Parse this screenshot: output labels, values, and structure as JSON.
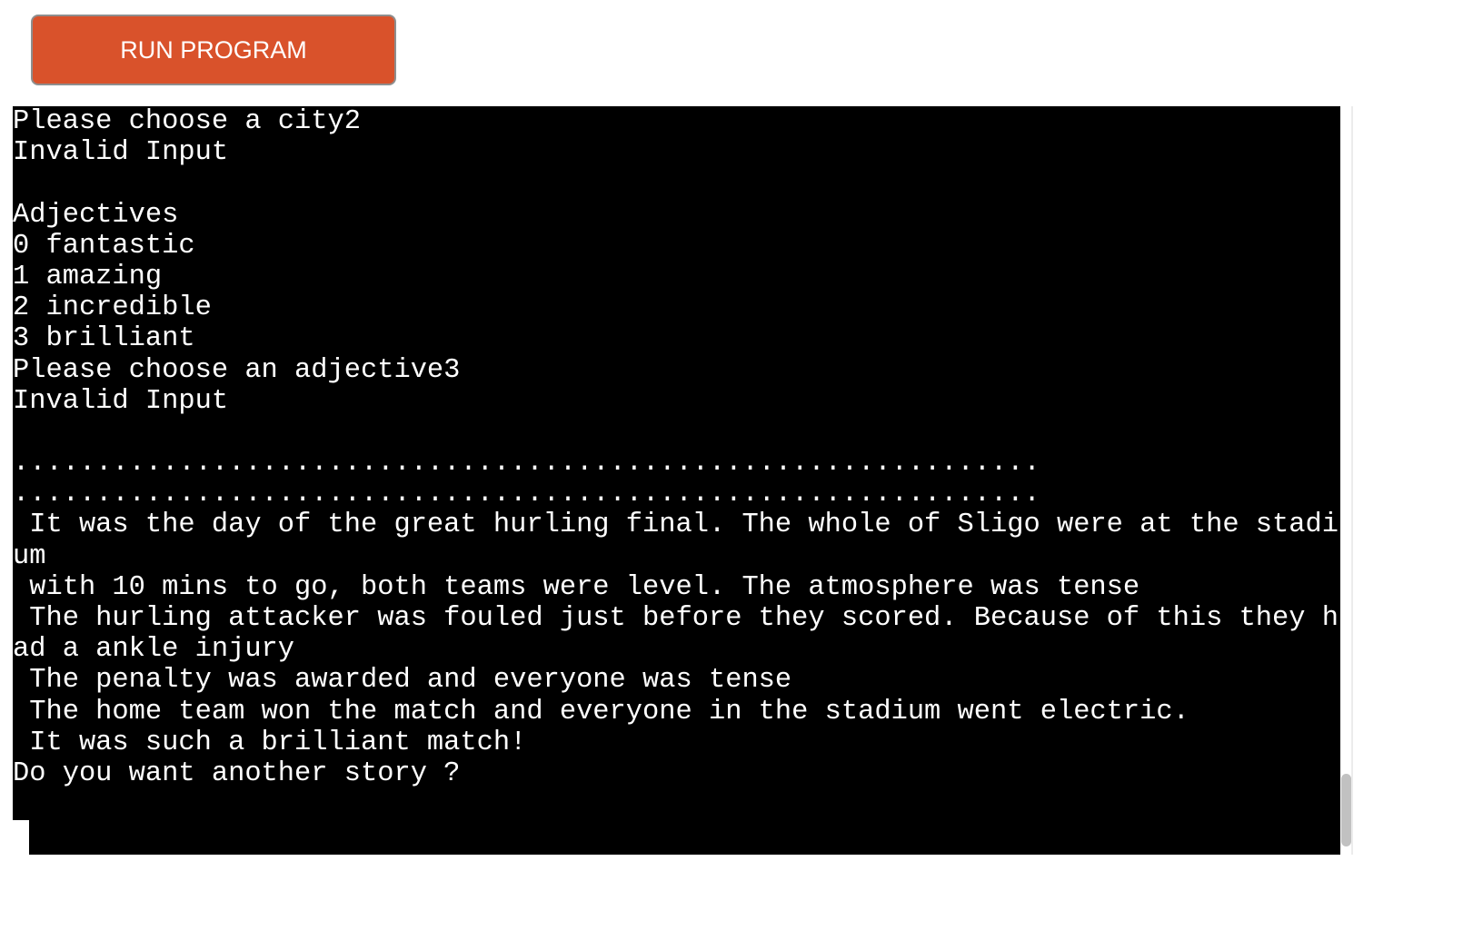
{
  "toolbar": {
    "run_label": "RUN PROGRAM",
    "run_color": "#d9522b"
  },
  "terminal": {
    "background": "#000000",
    "text_color": "#ffffff",
    "lines": [
      "Please choose a city2",
      "Invalid Input",
      "",
      "Adjectives",
      "0 fantastic",
      "1 amazing",
      "2 incredible",
      "3 brilliant",
      "Please choose an adjective3",
      "Invalid Input",
      "",
      "..............................................................",
      "..............................................................",
      " It was the day of the great hurling final. The whole of Sligo were at the stadi",
      "um",
      " with 10 mins to go, both teams were level. The atmosphere was tense",
      " The hurling attacker was fouled just before they scored. Because of this they h",
      "ad a ankle injury",
      " The penalty was awarded and everyone was tense",
      " The home team won the match and everyone in the stadium went electric.",
      " It was such a brilliant match!",
      "Do you want another story ?"
    ]
  }
}
